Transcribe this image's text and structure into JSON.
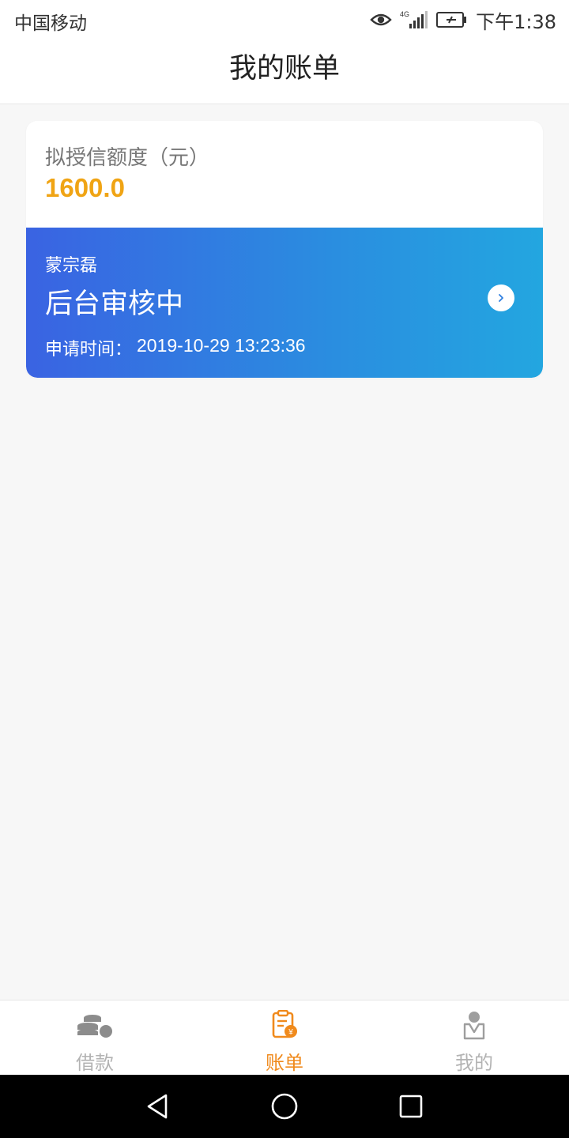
{
  "status_bar": {
    "carrier": "中国移动",
    "network": "4G",
    "time": "下午1:38",
    "icons": [
      "eye-icon",
      "signal-icon",
      "battery-icon"
    ]
  },
  "header": {
    "title": "我的账单"
  },
  "credit": {
    "label": "拟授信额度（元）",
    "amount": "1600.0"
  },
  "application": {
    "applicant": "蒙宗磊",
    "status": "后台审核中",
    "time_label": "申请时间：",
    "time_value": "2019-10-29 13:23:36"
  },
  "tabbar": {
    "items": [
      {
        "label": "借款",
        "icon": "coins-icon",
        "active": false
      },
      {
        "label": "账单",
        "icon": "bill-icon",
        "active": true
      },
      {
        "label": "我的",
        "icon": "profile-icon",
        "active": false
      }
    ]
  },
  "colors": {
    "accent": "#f0a414",
    "tab_active": "#f08a1c",
    "gradient_start": "#3a63e2",
    "gradient_end": "#23a6e0"
  }
}
